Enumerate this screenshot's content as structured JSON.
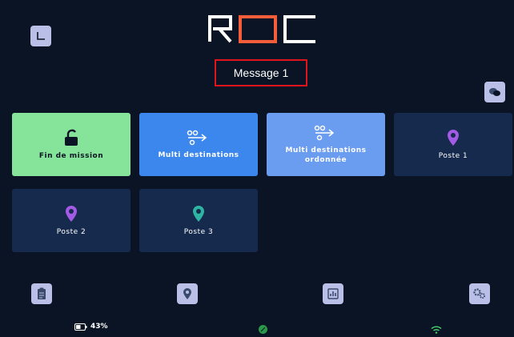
{
  "header": {
    "logo_text": "ROC",
    "message": "Message 1"
  },
  "colors": {
    "background": "#0b1424",
    "accent": "#f45d3a",
    "green": "#85e39a",
    "blue": "#3c87ee",
    "lightblue": "#6a9cf0",
    "dark_tile": "#162a4d",
    "message_border": "#e0141b"
  },
  "tiles": [
    {
      "label": "Fin de mission",
      "icon": "unlock-icon"
    },
    {
      "label": "Multi destinations",
      "icon": "route-icon"
    },
    {
      "label": "Multi destinations ordonnée",
      "icon": "route-icon"
    },
    {
      "label": "Poste 1",
      "icon": "purple-location-pin-icon"
    },
    {
      "label": "Poste 2",
      "icon": "purple-location-pin-icon"
    },
    {
      "label": "Poste 3",
      "icon": "teal-location-pin-icon"
    }
  ],
  "bottom_nav": [
    {
      "icon": "clipboard-icon"
    },
    {
      "icon": "location-icon"
    },
    {
      "icon": "chart-icon"
    },
    {
      "icon": "settings-icon"
    }
  ],
  "status_bar": {
    "battery": "43%",
    "icons": [
      "battery-icon",
      "leaf-icon",
      "wifi-icon"
    ]
  }
}
